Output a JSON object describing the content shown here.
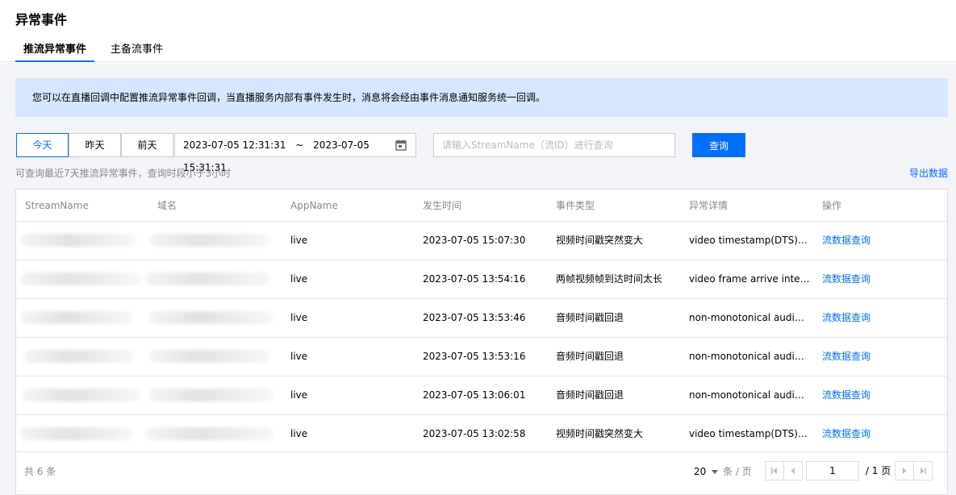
{
  "page": {
    "title": "异常事件",
    "tabs": [
      {
        "label": "推流异常事件",
        "active": true
      },
      {
        "label": "主备流事件",
        "active": false
      }
    ]
  },
  "notice": "您可以在直播回调中配置推流异常事件回调，当直播服务内部有事件发生时，消息将会经由事件消息通知服务统一回调。",
  "filters": {
    "day_buttons": [
      "今天",
      "昨天",
      "前天"
    ],
    "active_day": "今天",
    "start_time": "2023-07-05 12:31:31",
    "separator": "~",
    "end_time": "2023-07-05 15:31:31",
    "search_placeholder": "请输入StreamName（流ID）进行查询",
    "search_value": "",
    "query_button": "查询"
  },
  "hint": "可查询最近7天推流异常事件，查询时段小于3小时",
  "export_label": "导出数据",
  "table": {
    "columns": [
      "StreamName",
      "域名",
      "AppName",
      "发生时间",
      "事件类型",
      "异常详情",
      "操作"
    ],
    "rows": [
      {
        "app": "live",
        "time": "2023-07-05 15:07:30",
        "type": "视频时间戳突然变大",
        "detail": "video timestamp(DTS) d...",
        "action": "流数据查询"
      },
      {
        "app": "live",
        "time": "2023-07-05 13:54:16",
        "type": "两帧视频帧到达时间太长",
        "detail": "video frame arrive interv...",
        "action": "流数据查询"
      },
      {
        "app": "live",
        "time": "2023-07-05 13:53:46",
        "type": "音频时间戳回退",
        "detail": "non-monotonical audio ti...",
        "action": "流数据查询"
      },
      {
        "app": "live",
        "time": "2023-07-05 13:53:16",
        "type": "音频时间戳回退",
        "detail": "non-monotonical audio ti...",
        "action": "流数据查询"
      },
      {
        "app": "live",
        "time": "2023-07-05 13:06:01",
        "type": "音频时间戳回退",
        "detail": "non-monotonical audio ti...",
        "action": "流数据查询"
      },
      {
        "app": "live",
        "time": "2023-07-05 13:02:58",
        "type": "视频时间戳突然变大",
        "detail": "video timestamp(DTS) d...",
        "action": "流数据查询"
      }
    ]
  },
  "footer": {
    "total": "共 6 条",
    "page_size": "20",
    "page_size_unit": "条 / 页",
    "current_page": "1",
    "total_pages": "/ 1 页"
  },
  "icons": [
    "calendar-icon",
    "chevron-down-icon",
    "first-page-icon",
    "prev-page-icon",
    "next-page-icon",
    "last-page-icon"
  ],
  "colors": {
    "accent": "#006eff",
    "notice_bg": "#d5e7ff",
    "page_bg": "#f3f4f7"
  }
}
